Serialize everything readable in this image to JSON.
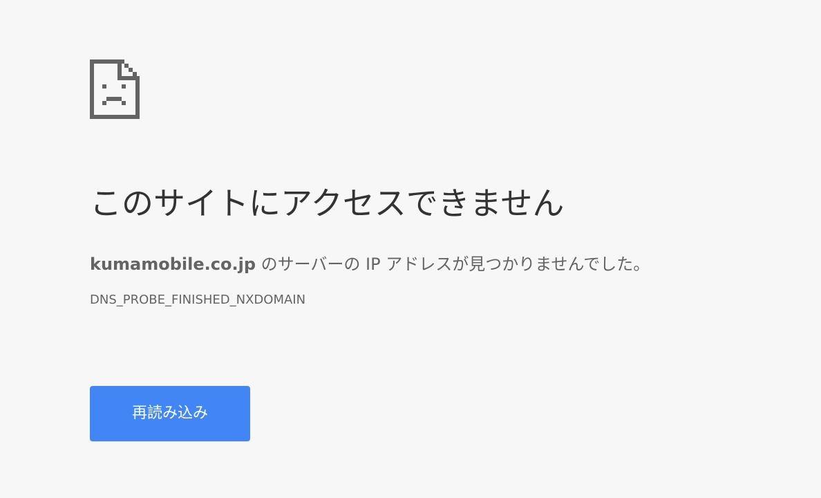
{
  "main": {
    "icon": "sad-page-icon",
    "heading": "このサイトにアクセスできません",
    "message_host": "kumamobile.co.jp",
    "message_rest": " のサーバーの IP アドレスが見つかりませんでした。",
    "error_code": "DNS_PROBE_FINISHED_NXDOMAIN",
    "reload_label": "再読み込み"
  },
  "colors": {
    "background": "#f7f7f7",
    "icon": "#646464",
    "heading": "#333333",
    "text": "#646464",
    "button": "#4285f4",
    "button_text": "#ffffff"
  }
}
